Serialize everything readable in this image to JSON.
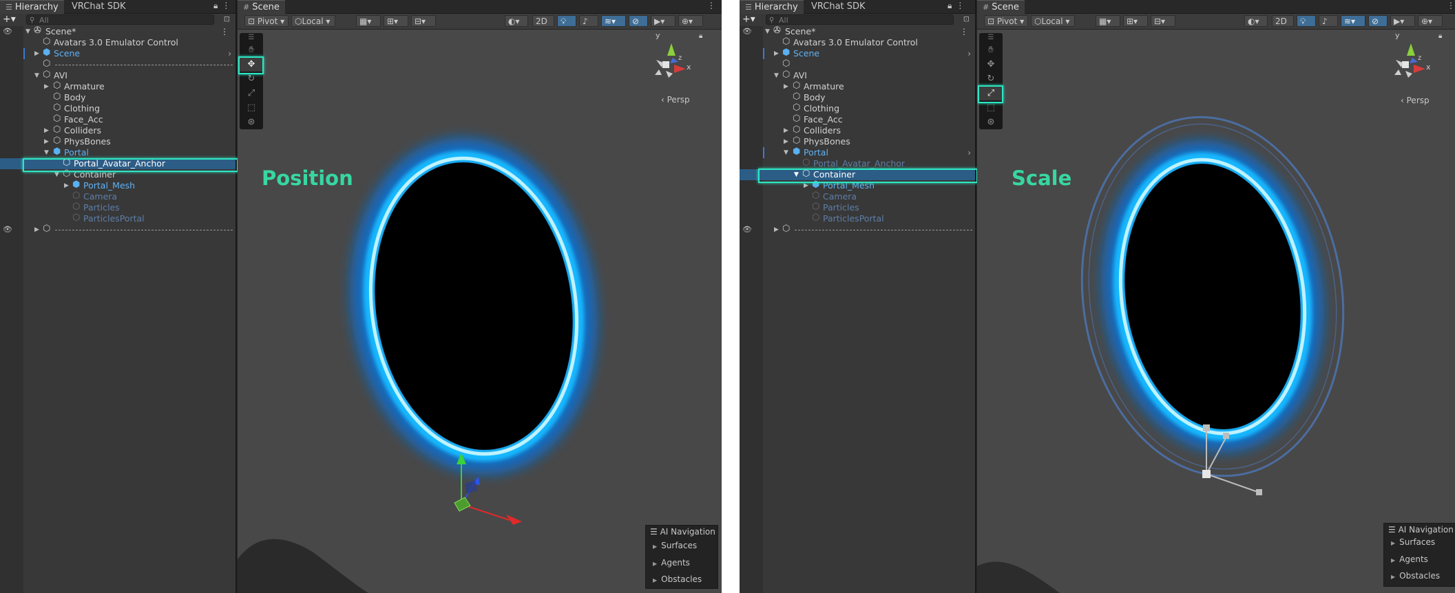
{
  "tabs": {
    "hierarchy": "Hierarchy",
    "vrchat_sdk": "VRChat SDK",
    "scene": "Scene"
  },
  "search": {
    "placeholder": "All"
  },
  "hierarchy_tree": {
    "scene": "Scene*",
    "emulator": "Avatars 3.0 Emulator Control",
    "scene_item": "Scene",
    "avi": "AVI",
    "armature": "Armature",
    "body": "Body",
    "clothing": "Clothing",
    "face_acc": "Face_Acc",
    "colliders": "Colliders",
    "physbones": "PhysBones",
    "portal": "Portal",
    "portal_avatar_anchor": "Portal_Avatar_Anchor",
    "container": "Container",
    "portal_mesh": "Portal_Mesh",
    "camera": "Camera",
    "particles": "Particles",
    "particles_portal": "ParticlesPortal"
  },
  "toolbar": {
    "pivot": "Pivot",
    "local": "Local",
    "mode_2d": "2D"
  },
  "gizmo": {
    "persp": "Persp",
    "x": "x",
    "y": "y",
    "z": "z"
  },
  "ai_navigation": {
    "title": "AI Navigation",
    "items": [
      "Surfaces",
      "Agents",
      "Obstacles"
    ]
  },
  "annotations": {
    "left": "Position",
    "right": "Scale"
  },
  "colors": {
    "highlight": "#2ee6c4",
    "annotation": "#37d7a2",
    "portal_glow": "#16b8ff",
    "selection": "#2c5d87"
  },
  "icons": [
    "hand-icon",
    "move-icon",
    "rotate-icon",
    "scale-icon",
    "rect-icon",
    "transform-icon",
    "eye-icon",
    "lock-icon",
    "kebab-icon",
    "cube-icon",
    "prefab-icon",
    "unity-icon"
  ]
}
